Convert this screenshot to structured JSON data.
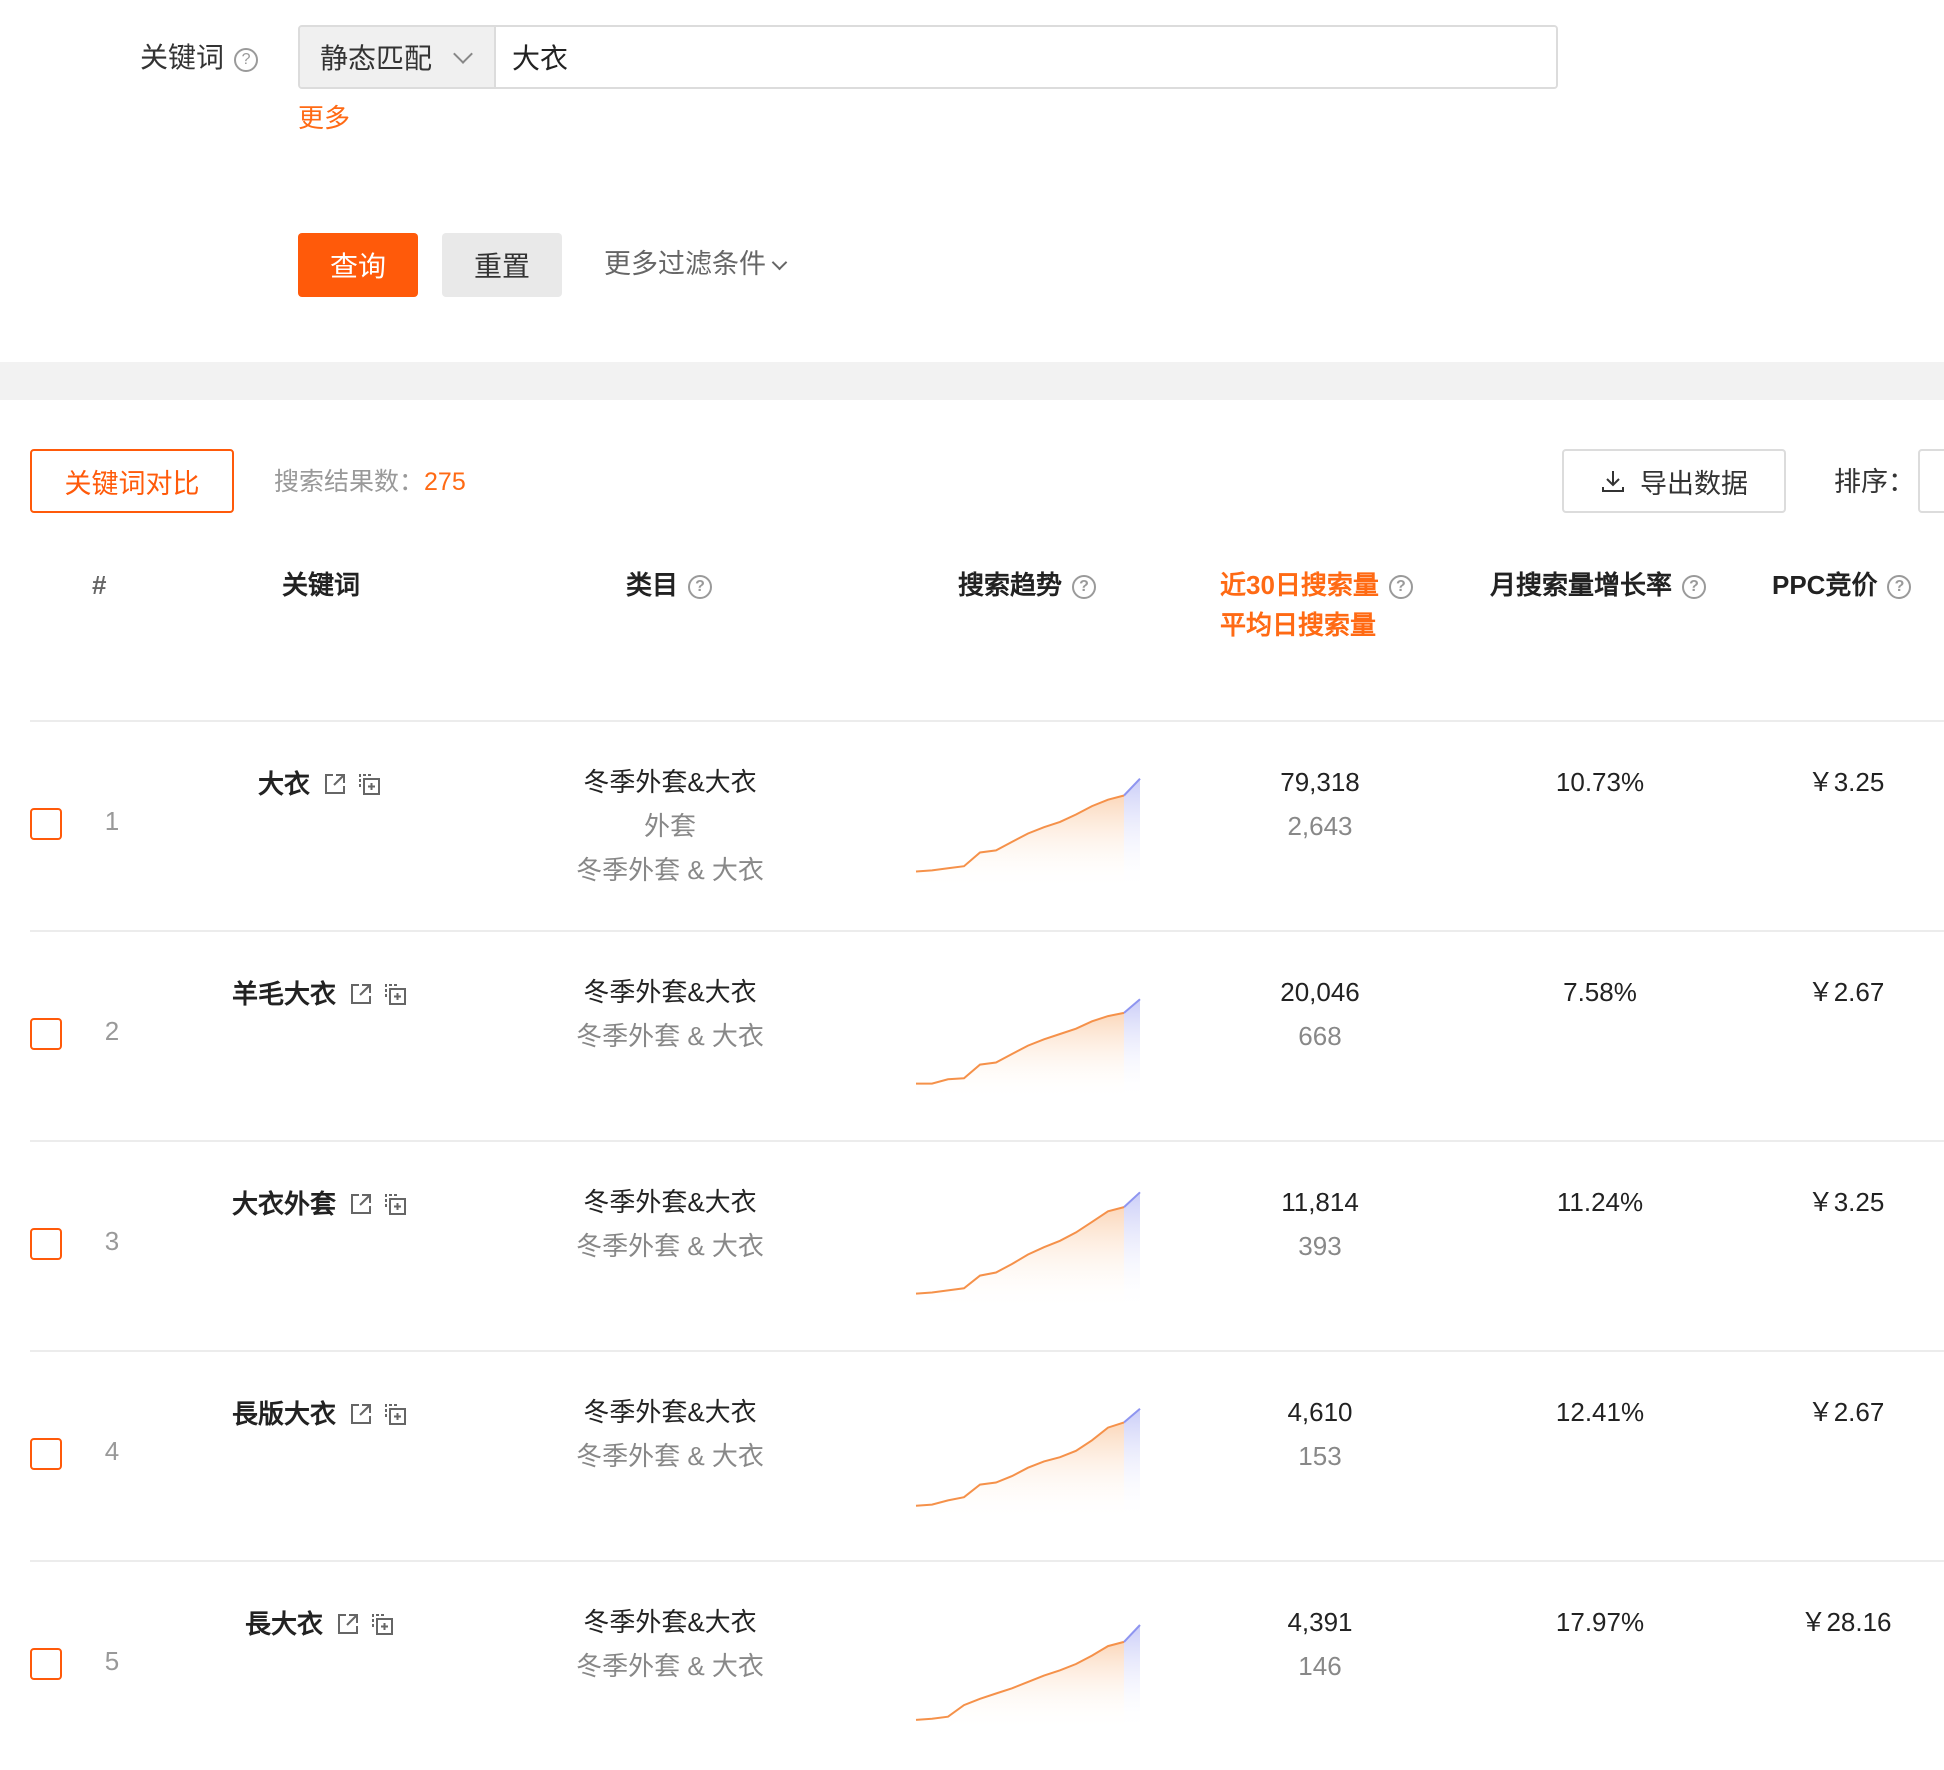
{
  "filter": {
    "keyword_label": "关键词",
    "match_type": "静态匹配",
    "keyword_value": "大衣",
    "more_link": "更多",
    "query_button": "查询",
    "reset_button": "重置",
    "more_filters": "更多过滤条件"
  },
  "toolbar": {
    "compare_button": "关键词对比",
    "result_count_label": "搜索结果数：",
    "result_count": "275",
    "export_button": "导出数据",
    "sort_label": "排序："
  },
  "table": {
    "headers": {
      "rank": "#",
      "keyword": "关键词",
      "category": "类目",
      "trend": "搜索趋势",
      "search_30d": "近30日搜索量",
      "search_daily": "平均日搜索量",
      "growth": "月搜索量增长率",
      "ppc": "PPC竞价"
    },
    "rows": [
      {
        "rank": "1",
        "keyword": "大衣",
        "categories": [
          "冬季外套&大衣",
          "外套",
          "冬季外套 & 大衣"
        ],
        "search_30d": "79,318",
        "search_daily": "2,643",
        "growth": "10.73%",
        "ppc": "￥3.25",
        "trend": [
          10,
          11,
          13,
          15,
          28,
          30,
          38,
          46,
          52,
          57,
          64,
          72,
          78,
          82,
          98
        ]
      },
      {
        "rank": "2",
        "keyword": "羊毛大衣",
        "categories": [
          "冬季外套&大衣",
          "冬季外套 & 大衣"
        ],
        "search_30d": "20,046",
        "search_daily": "668",
        "growth": "7.58%",
        "ppc": "￥2.67",
        "trend": [
          8,
          8,
          12,
          13,
          26,
          28,
          36,
          44,
          50,
          55,
          60,
          67,
          72,
          75,
          88
        ]
      },
      {
        "rank": "3",
        "keyword": "大衣外套",
        "categories": [
          "冬季外套&大衣",
          "冬季外套 & 大衣"
        ],
        "search_30d": "11,814",
        "search_daily": "393",
        "growth": "11.24%",
        "ppc": "￥3.25",
        "trend": [
          8,
          9,
          11,
          13,
          25,
          28,
          36,
          45,
          52,
          58,
          66,
          76,
          86,
          90,
          104
        ]
      },
      {
        "rank": "4",
        "keyword": "長版大衣",
        "categories": [
          "冬季外套&大衣",
          "冬季外套 & 大衣"
        ],
        "search_30d": "4,610",
        "search_daily": "153",
        "growth": "12.41%",
        "ppc": "￥2.67",
        "trend": [
          6,
          7,
          11,
          14,
          26,
          28,
          34,
          42,
          48,
          52,
          58,
          68,
          80,
          85,
          98
        ]
      },
      {
        "rank": "5",
        "keyword": "長大衣",
        "categories": [
          "冬季外套&大衣",
          "冬季外套 & 大衣"
        ],
        "search_30d": "4,391",
        "search_daily": "146",
        "growth": "17.97%",
        "ppc": "￥28.16",
        "trend": [
          2,
          3,
          5,
          16,
          22,
          27,
          32,
          38,
          44,
          49,
          55,
          63,
          72,
          76,
          92
        ]
      }
    ]
  },
  "colors": {
    "accent": "#ff5a0a",
    "trend_line": "#f5914a",
    "trend_highlight": "#8e95f0"
  },
  "icons": [
    "help-circle-icon",
    "chevron-down-icon",
    "external-link-icon",
    "copy-icon",
    "download-icon"
  ]
}
